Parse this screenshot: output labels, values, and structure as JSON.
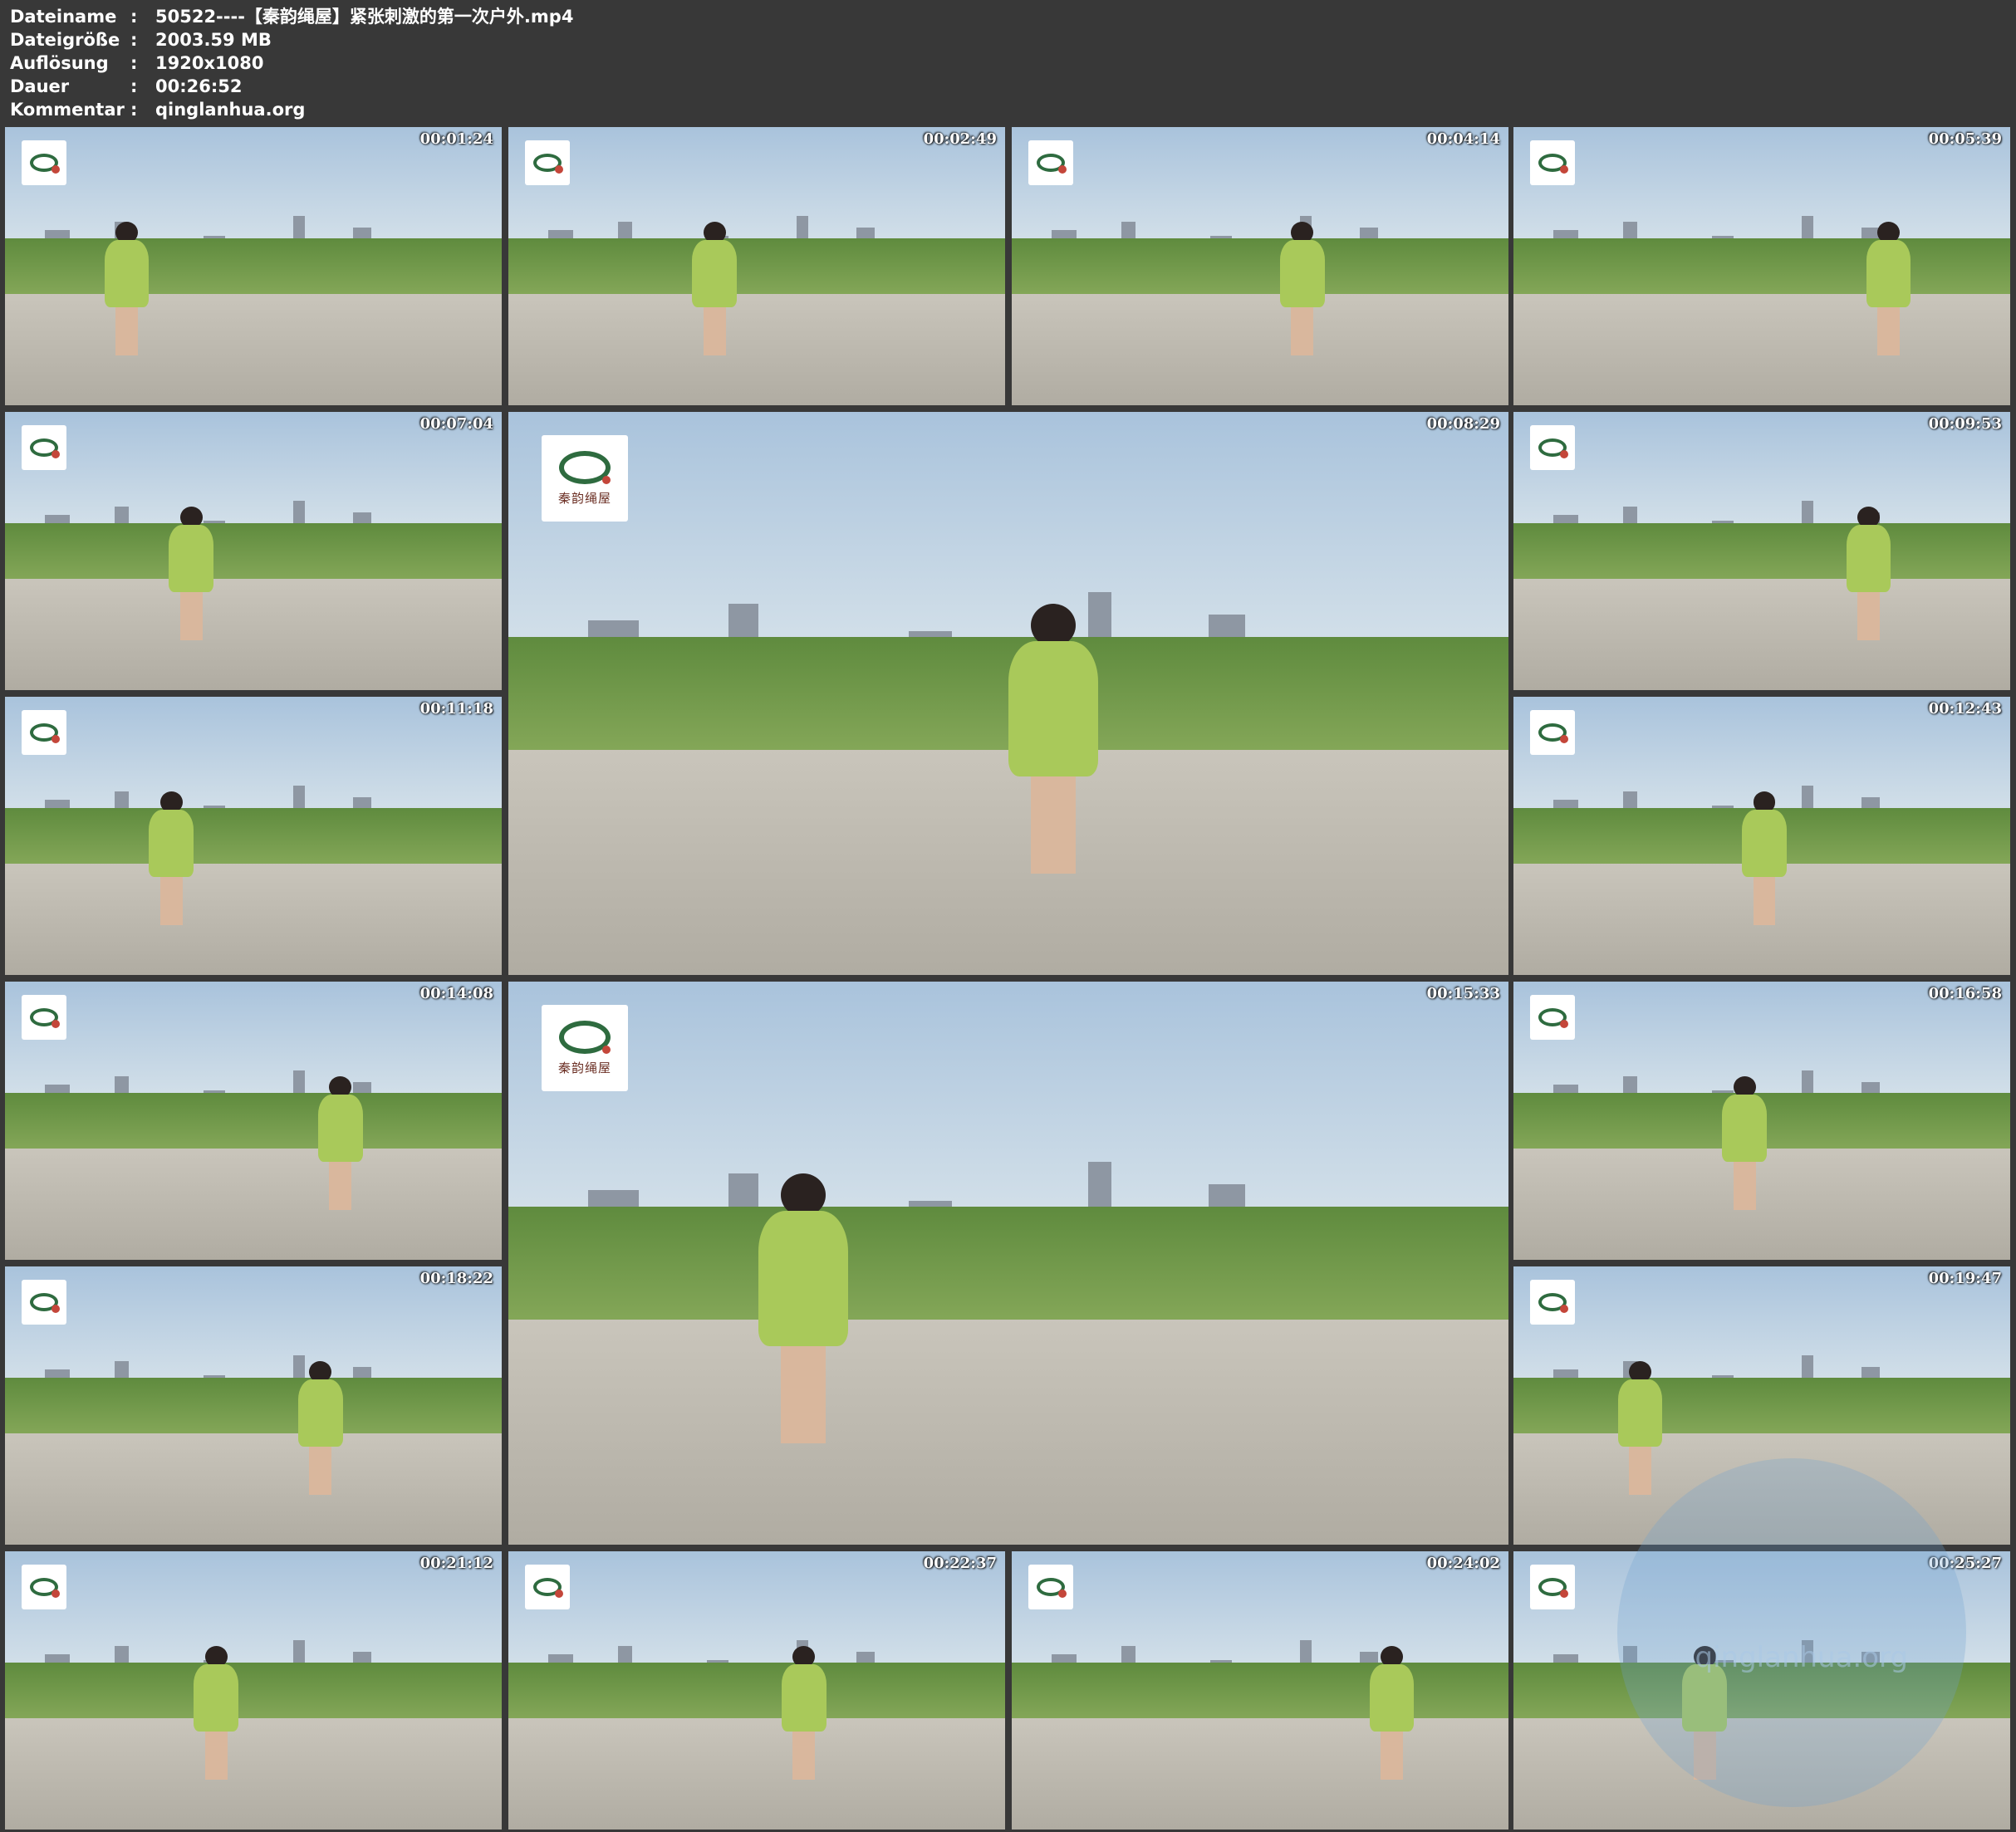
{
  "header": {
    "rows": [
      {
        "label": "Dateiname",
        "value": "50522----【秦韵绳屋】紧张刺激的第一次户外.mp4"
      },
      {
        "label": "Dateigröße",
        "value": "2003.59 MB"
      },
      {
        "label": "Auflösung",
        "value": "1920x1080"
      },
      {
        "label": "Dauer",
        "value": "00:26:52"
      },
      {
        "label": "Kommentar",
        "value": "qinglanhua.org"
      }
    ]
  },
  "logo": {
    "sign": "秦韵绳屋"
  },
  "watermark": {
    "text": "qinglanhua.org"
  },
  "thumbnails": [
    {
      "time": "00:01:24"
    },
    {
      "time": "00:02:49"
    },
    {
      "time": "00:04:14"
    },
    {
      "time": "00:05:39"
    },
    {
      "time": "00:07:04"
    },
    {
      "time": "00:08:29"
    },
    {
      "time": "00:09:53"
    },
    {
      "time": "00:11:18"
    },
    {
      "time": "00:12:43"
    },
    {
      "time": "00:14:08"
    },
    {
      "time": "00:15:33"
    },
    {
      "time": "00:16:58"
    },
    {
      "time": "00:18:22"
    },
    {
      "time": "00:19:47"
    },
    {
      "time": "00:21:12"
    },
    {
      "time": "00:22:37"
    },
    {
      "time": "00:24:02"
    },
    {
      "time": "00:25:27"
    }
  ]
}
